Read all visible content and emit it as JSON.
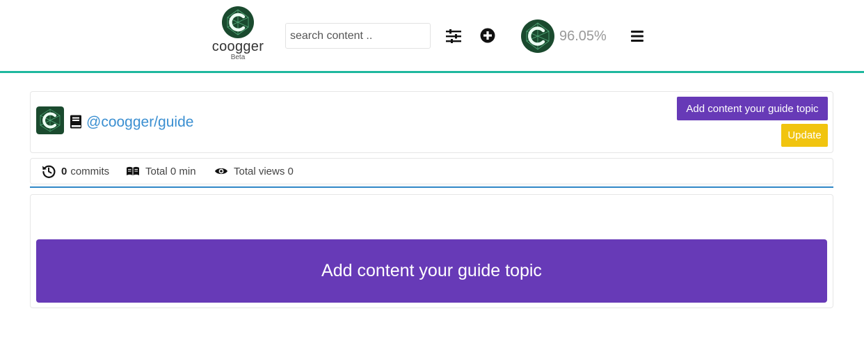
{
  "header": {
    "logo_name": "coogger",
    "logo_badge": "Beta",
    "search_placeholder": "search content ..",
    "voting_power": "96.05%"
  },
  "guide": {
    "link": "@coogger/guide",
    "add_button": "Add content your guide topic",
    "update_button": "Update"
  },
  "stats": {
    "commits_count": "0",
    "commits_label": "commits",
    "total_time": "Total 0 min",
    "total_views": "Total views 0"
  },
  "content": {
    "add_button": "Add content your guide topic"
  },
  "colors": {
    "brand_green": "#1a4a2e",
    "header_rule": "#1fb89e",
    "purple": "#673ab7",
    "update_yellow": "#f1c40f",
    "link_blue": "#3b8fd1",
    "stats_rule": "#2f87c6"
  }
}
